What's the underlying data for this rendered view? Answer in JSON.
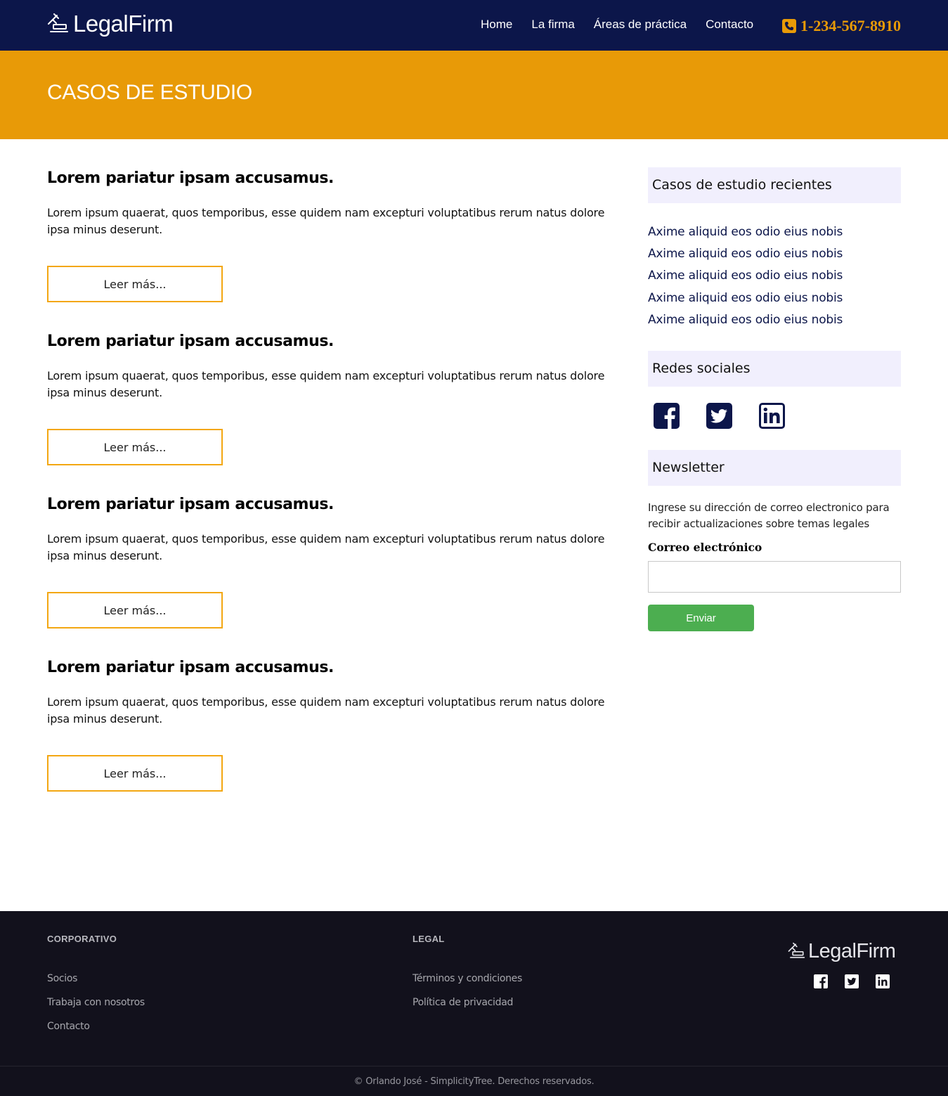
{
  "header": {
    "logo_text": "LegalFirm",
    "nav": [
      "Home",
      "La firma",
      "Áreas de práctica",
      "Contacto"
    ],
    "phone": "1-234-567-8910"
  },
  "banner": {
    "title": "CASOS DE ESTUDIO"
  },
  "cases": [
    {
      "title": "Lorem pariatur ipsam accusamus.",
      "text": "Lorem ipsum quaerat, quos temporibus, esse quidem nam excepturi voluptatibus rerum natus dolore ipsa minus deserunt.",
      "button": "Leer más..."
    },
    {
      "title": "Lorem pariatur ipsam accusamus.",
      "text": "Lorem ipsum quaerat, quos temporibus, esse quidem nam excepturi voluptatibus rerum natus dolore ipsa minus deserunt.",
      "button": "Leer más..."
    },
    {
      "title": "Lorem pariatur ipsam accusamus.",
      "text": "Lorem ipsum quaerat, quos temporibus, esse quidem nam excepturi voluptatibus rerum natus dolore ipsa minus deserunt.",
      "button": "Leer más..."
    },
    {
      "title": "Lorem pariatur ipsam accusamus.",
      "text": "Lorem ipsum quaerat, quos temporibus, esse quidem nam excepturi voluptatibus rerum natus dolore ipsa minus deserunt.",
      "button": "Leer más..."
    }
  ],
  "sidebar": {
    "recent_title": "Casos de estudio recientes",
    "recent_items": [
      "Axime aliquid eos odio eius nobis",
      "Axime aliquid eos odio eius nobis",
      "Axime aliquid eos odio eius nobis",
      "Axime aliquid eos odio eius nobis",
      "Axime aliquid eos odio eius nobis"
    ],
    "social_title": "Redes sociales",
    "social_icons": [
      "facebook-icon",
      "twitter-icon",
      "linkedin-icon"
    ],
    "newsletter_title": "Newsletter",
    "newsletter_text": "Ingrese su dirección de correo electronico para recibir actualizaciones sobre temas legales",
    "email_label": "Correo electrónico",
    "email_value": "",
    "submit_label": "Enviar"
  },
  "footer": {
    "col1_title": "CORPORATIVO",
    "col1_links": [
      "Socios",
      "Trabaja con nosotros",
      "Contacto"
    ],
    "col2_title": "LEGAL",
    "col2_links": [
      "Términos y condiciones",
      "Política de privacidad"
    ],
    "logo_text": "LegalFirm",
    "social_icons": [
      "facebook-icon",
      "twitter-icon",
      "linkedin-icon"
    ],
    "copyright": "© Orlando José - SimplicityTree. Derechos reservados."
  },
  "colors": {
    "navy": "#0c164a",
    "accent": "#e89a07",
    "sidebar_head_bg": "#f1effd",
    "submit_green": "#4cae50",
    "footer_bg": "#12111c"
  }
}
